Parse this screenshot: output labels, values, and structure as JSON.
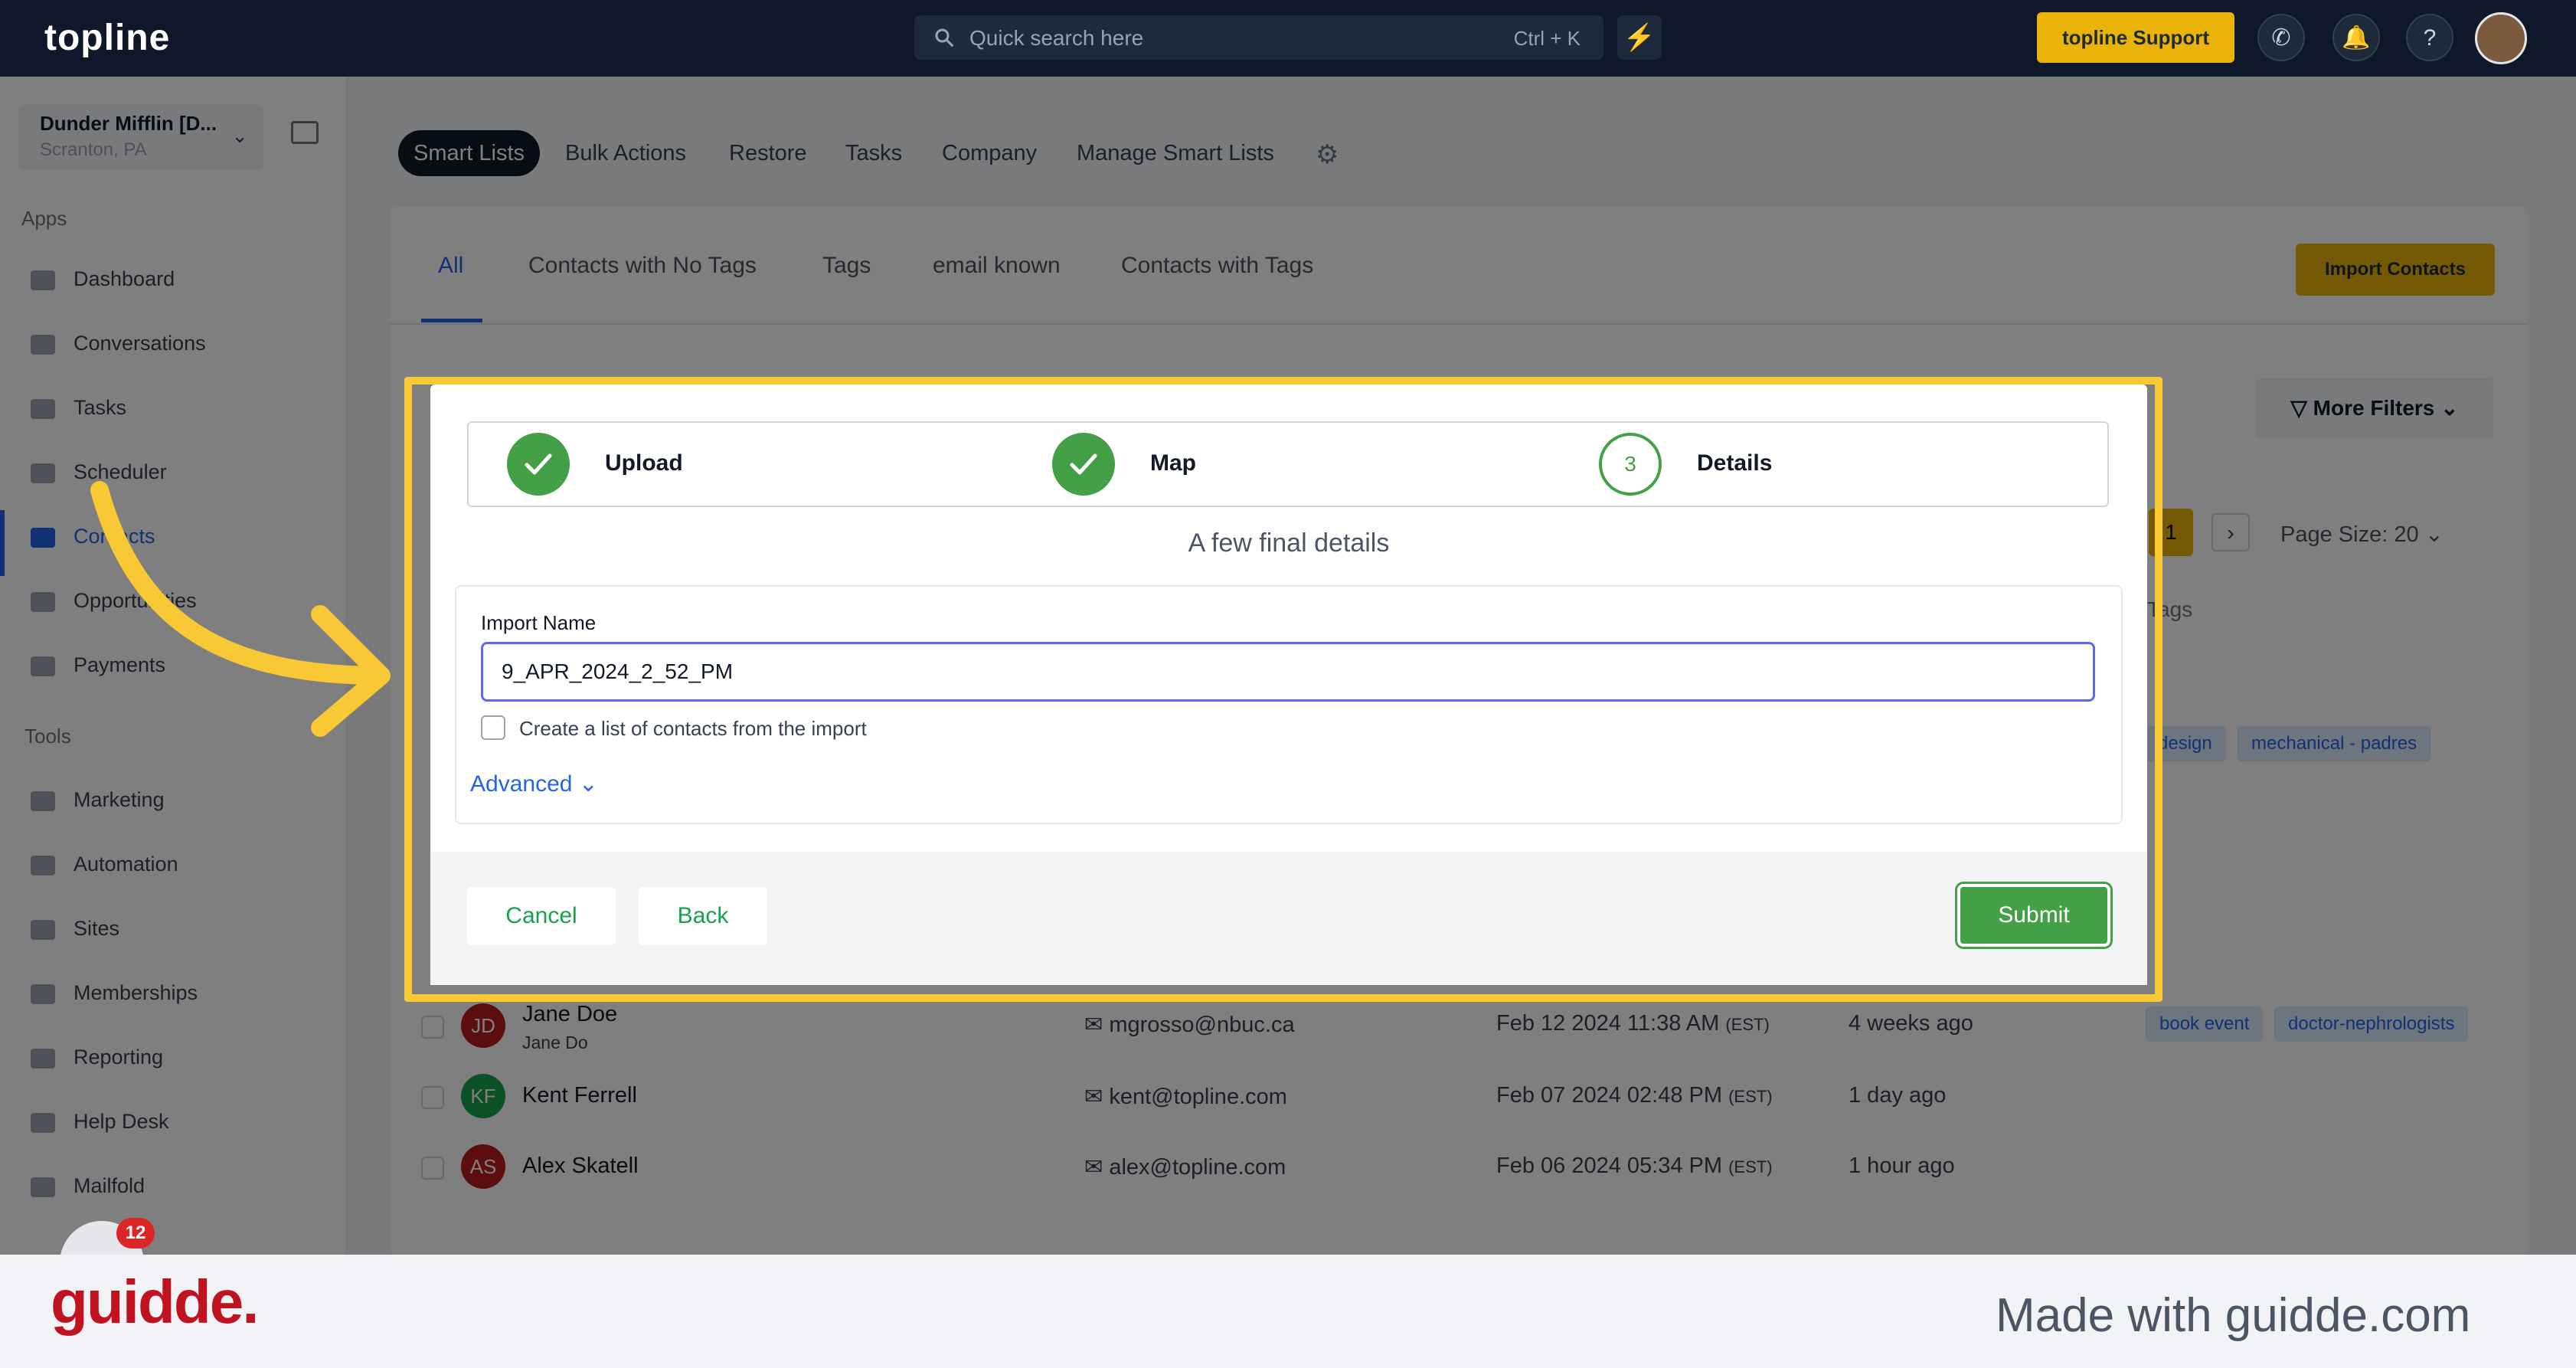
{
  "topbar": {
    "logo": "topline",
    "search_placeholder": "Quick search here",
    "search_shortcut": "Ctrl + K",
    "support_label": "topline Support",
    "icons": [
      "search-icon",
      "lightning-icon",
      "phone-icon",
      "bell-icon",
      "help-icon",
      "avatar"
    ]
  },
  "sidebar": {
    "location_name": "Dunder Mifflin [D...",
    "location_city": "Scranton, PA",
    "apps_heading": "Apps",
    "apps": [
      {
        "label": "Dashboard"
      },
      {
        "label": "Conversations"
      },
      {
        "label": "Tasks"
      },
      {
        "label": "Scheduler"
      },
      {
        "label": "Contacts"
      },
      {
        "label": "Opportunities"
      },
      {
        "label": "Payments"
      }
    ],
    "tools_heading": "Tools",
    "tools": [
      {
        "label": "Marketing"
      },
      {
        "label": "Automation"
      },
      {
        "label": "Sites"
      },
      {
        "label": "Memberships"
      },
      {
        "label": "Reporting"
      },
      {
        "label": "Help Desk"
      },
      {
        "label": "Mailfold"
      }
    ],
    "notification_count": "12"
  },
  "main": {
    "subtabs": [
      "Smart Lists",
      "Bulk Actions",
      "Restore",
      "Tasks",
      "Company",
      "Manage Smart Lists"
    ],
    "list_tabs": [
      "All",
      "Contacts with No Tags",
      "Tags",
      "email known",
      "Contacts with Tags"
    ],
    "import_contacts": "Import Contacts",
    "more_filters": "More Filters",
    "page_size": "Page Size: 20",
    "page_current": "1",
    "col_tags": "Tags",
    "tags_behind": [
      "design",
      "mechanical - padres"
    ],
    "rows": [
      {
        "initials": "JD",
        "name": "Jane Doe",
        "sub": "Jane Do",
        "email": "mgrosso@nbuc.ca",
        "date": "Feb 12 2024 11:38 AM",
        "tz": "(EST)",
        "activity": "4 weeks ago",
        "tags": [
          "book event",
          "doctor-nephrologists"
        ]
      },
      {
        "initials": "KF",
        "name": "Kent Ferrell",
        "sub": "",
        "email": "kent@topline.com",
        "date": "Feb 07 2024 02:48 PM",
        "tz": "(EST)",
        "activity": "1 day ago",
        "tags": []
      },
      {
        "initials": "AS",
        "name": "Alex Skatell",
        "sub": "",
        "email": "alex@topline.com",
        "date": "Feb 06 2024 05:34 PM",
        "tz": "(EST)",
        "activity": "1 hour ago",
        "tags": []
      }
    ]
  },
  "modal": {
    "steps": [
      {
        "label": "Upload",
        "state": "done"
      },
      {
        "label": "Map",
        "state": "done"
      },
      {
        "label": "Details",
        "state": "current",
        "number": "3"
      }
    ],
    "subtitle": "A few final details",
    "import_name_label": "Import Name",
    "import_name_value": "9_APR_2024_2_52_PM",
    "create_list_label": "Create a list of contacts from the import",
    "advanced_label": "Advanced",
    "cancel_label": "Cancel",
    "back_label": "Back",
    "submit_label": "Submit"
  },
  "footer": {
    "brand": "guidde.",
    "made_with": "Made with guidde.com"
  },
  "colors": {
    "highlight": "#f8c935",
    "success": "#43a047",
    "accent_yellow": "#eab308",
    "brand_red": "#c1121f"
  }
}
